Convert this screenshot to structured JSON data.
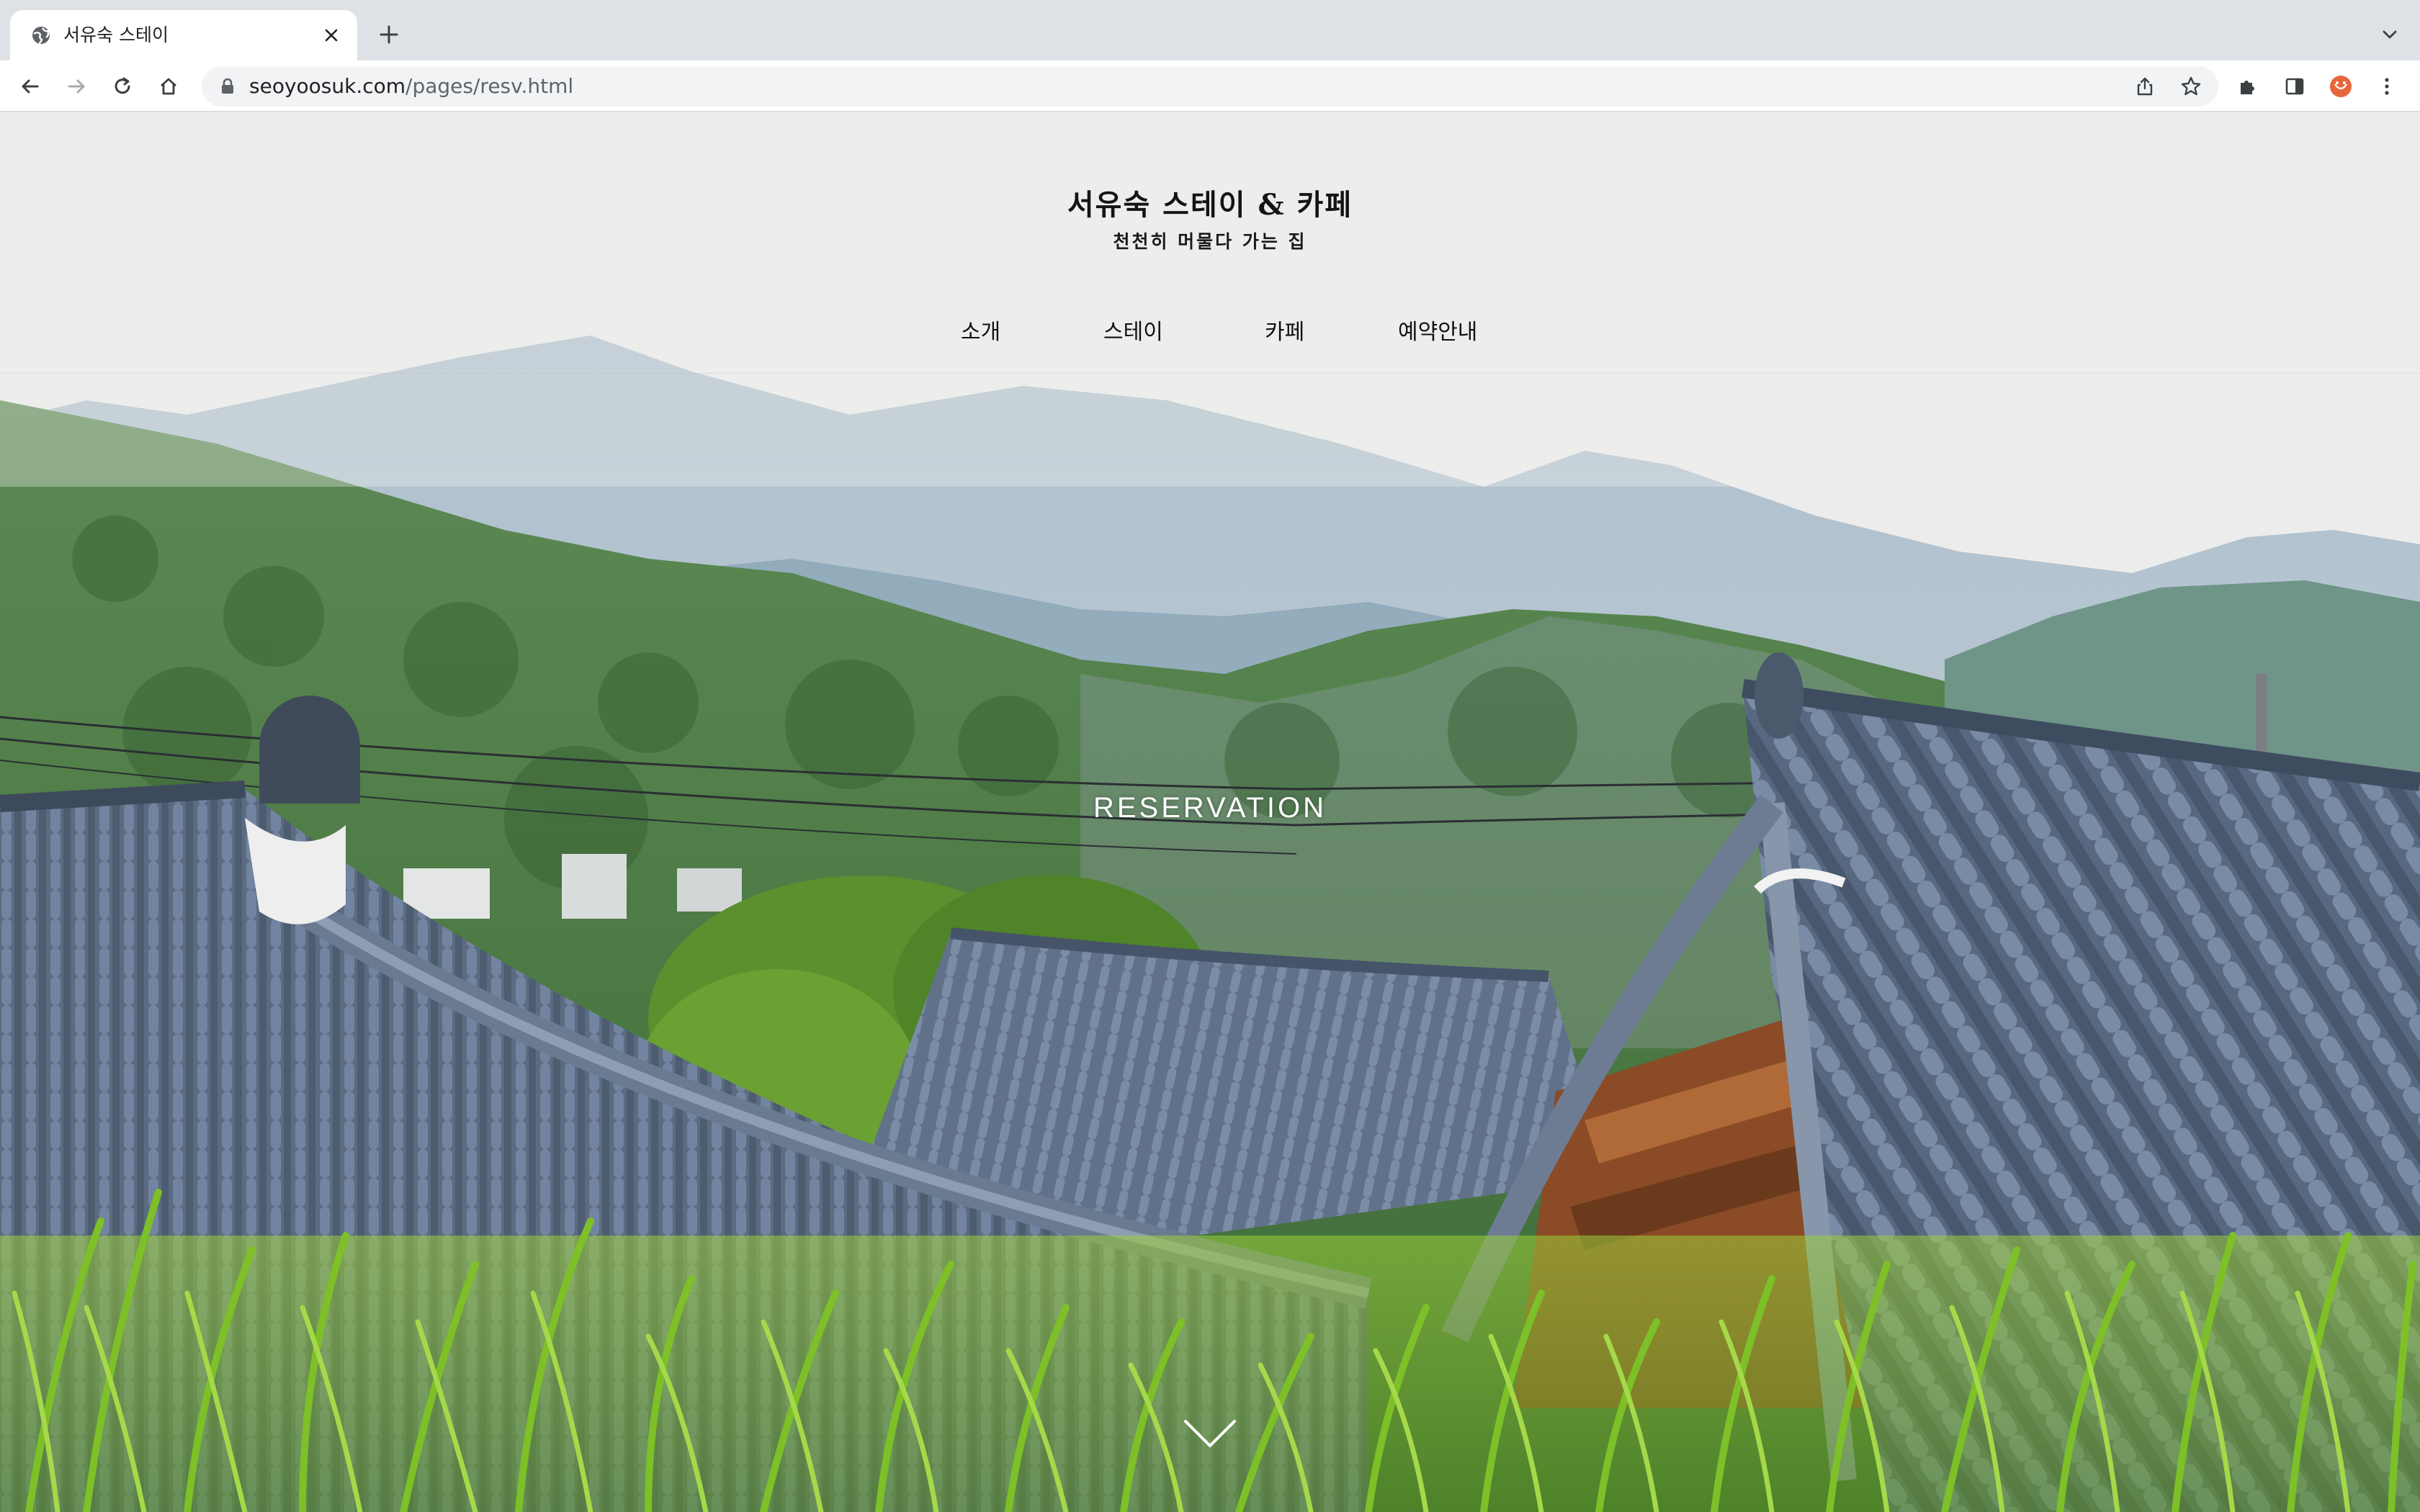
{
  "browser": {
    "tab_title": "서유숙 스테이",
    "url_domain": "seoyoosuk.com",
    "url_path": "/pages/resv.html"
  },
  "site": {
    "title": "서유숙 스테이 & 카페",
    "subtitle": "천천히 머물다 가는 집",
    "nav": [
      {
        "label": "소개"
      },
      {
        "label": "스테이"
      },
      {
        "label": "카페"
      },
      {
        "label": "예약안내"
      }
    ]
  },
  "hero": {
    "title": "RESERVATION"
  },
  "icons": {
    "favicon": "globe-icon",
    "scroll": "chevron-down-icon"
  },
  "colors": {
    "roof": "#5f7088",
    "grass": "#7fbf2a",
    "forest": "#4b7a3f"
  }
}
